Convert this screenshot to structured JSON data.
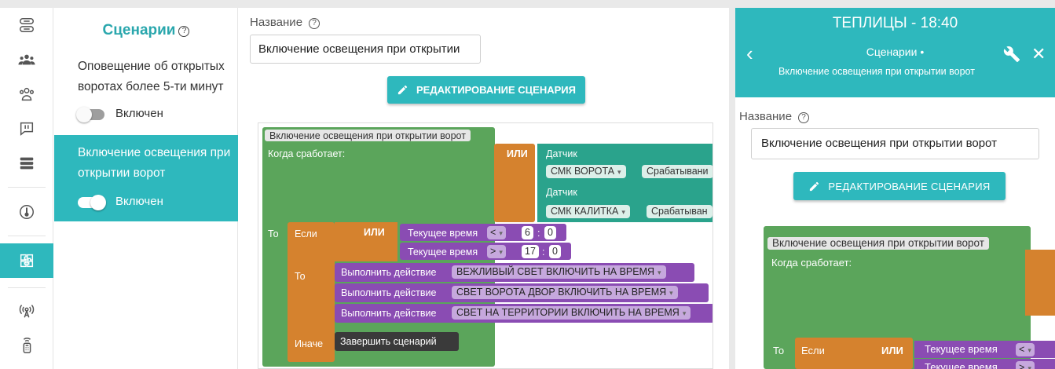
{
  "rail": {
    "items": [
      {
        "icon": "gateway-icon"
      },
      {
        "icon": "users-icon"
      },
      {
        "icon": "contacts-icon"
      },
      {
        "icon": "notifications-icon"
      },
      {
        "icon": "devices-list-icon"
      },
      {
        "icon": "thermometer-icon"
      },
      {
        "icon": "scenarios-icon",
        "active": true
      },
      {
        "icon": "radio-signal-icon"
      },
      {
        "icon": "remote-control-icon"
      }
    ]
  },
  "scenarios": {
    "title": "Сценарии",
    "help": "?",
    "items": [
      {
        "name": "Оповещение об открытых воротах более 5-ти минут",
        "toggle_label": "Включен",
        "enabled": false
      },
      {
        "name": "Включение освещения при открытии ворот",
        "toggle_label": "Включен",
        "enabled": true,
        "active": true
      }
    ]
  },
  "editor": {
    "name_label": "Название",
    "help": "?",
    "name_value": "Включение освещения при открытии",
    "edit_button": "РЕДАКТИРОВАНИЕ СЦЕНАРИЯ"
  },
  "blocks": {
    "header": "Включение освещения при открытии ворот",
    "when": "Когда сработает:",
    "or": "ИЛИ",
    "sensor": "Датчик",
    "sensor1": "СМК ВОРОТА",
    "sensor2": "СМК КАЛИТКА",
    "trigger": "Срабатывани",
    "trigger2": "Срабатыван",
    "to": "То",
    "if": "Если",
    "current_time": "Текущее время",
    "lt": "<",
    "gt": ">",
    "t1_h": "6",
    "t1_m": "0",
    "t2_h": "17",
    "t2_m": "0",
    "colon": ":",
    "then": "То",
    "exec": "Выполнить действие",
    "action1": "ВЕЖЛИВЫЙ СВЕТ ВКЛЮЧИТЬ НА ВРЕМЯ",
    "action2": "СВЕТ ВОРОТА ДВОР ВКЛЮЧИТЬ НА ВРЕМЯ",
    "action3": "СВЕТ НА ТЕРРИТОРИИ ВКЛЮЧИТЬ НА ВРЕМЯ",
    "else": "Иначе",
    "finish": "Завершить сценарий",
    "dd": "▾"
  },
  "mobile": {
    "title": "ТЕПЛИЦЫ - 18:40",
    "subtitle": "Сценарии •",
    "scenario_name": "Включение освещения при открытии ворот",
    "back": "‹",
    "close": "✕",
    "name_label": "Название",
    "help": "?",
    "name_value": "Включение освещения при открытии ворот",
    "edit_button": "РЕДАКТИРОВАНИЕ СЦЕНАРИЯ",
    "ws_header": "Включение освещения при открытии ворот",
    "ws_when": "Когда сработает:",
    "ws_to": "То",
    "ws_if": "Если",
    "ws_or": "ИЛИ",
    "ws_time": "Текущее время",
    "ws_lt": "<",
    "ws_gt": ">",
    "ws_dd": "▾"
  },
  "colors": {
    "accent": "#2eb8bd",
    "block_green": "#5ba55b",
    "block_orange": "#d5822e",
    "block_teal": "#2aa38c",
    "block_purple": "#8a4cb3"
  }
}
